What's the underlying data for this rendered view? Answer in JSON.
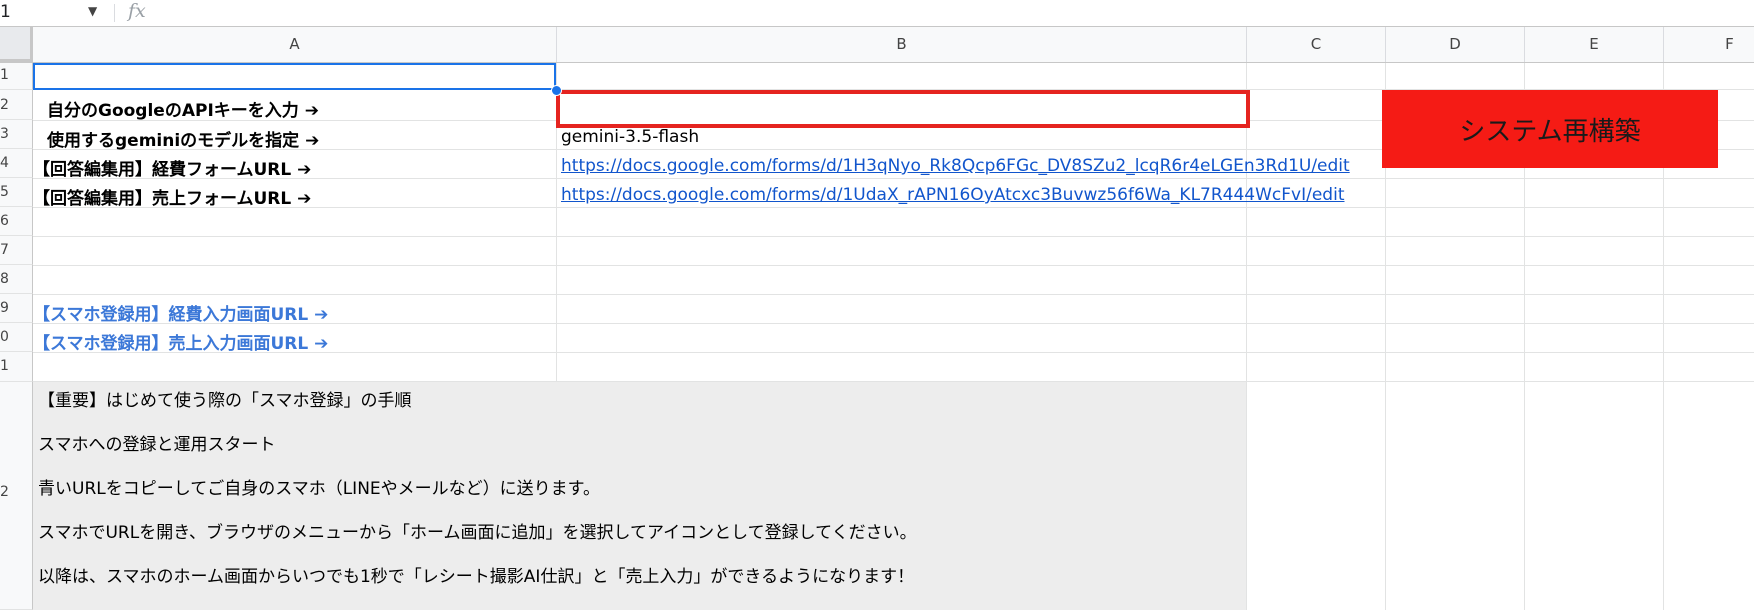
{
  "formula_bar": {
    "name_box": "1",
    "fx_label": "fx"
  },
  "columns": [
    "A",
    "B",
    "C",
    "D",
    "E",
    "F"
  ],
  "rows": [
    "1",
    "2",
    "3",
    "4",
    "5",
    "6",
    "7",
    "8",
    "9",
    "0",
    "1",
    "2"
  ],
  "cells": {
    "a2": "自分のGoogleのAPIキーを入力 ➔",
    "a3": "使用するgeminiのモデルを指定 ➔",
    "a4": "【回答編集用】経費フォームURL ➔",
    "a5": "【回答編集用】売上フォームURL ➔",
    "a9": "【スマホ登録用】経費入力画面URL ➔",
    "a10": "【スマホ登録用】売上入力画面URL ➔",
    "b2": "",
    "b3": "gemini-3.5-flash",
    "b4": "https://docs.google.com/forms/d/1H3qNyo_Rk8Qcp6FGc_DV8SZu2_lcqR6r4eLGEn3Rd1U/edit",
    "b5": "https://docs.google.com/forms/d/1UdaX_rAPN16OyAtcxc3Buvwz56f6Wa_KL7R444WcFvI/edit"
  },
  "note_lines": [
    "【重要】はじめて使う際の「スマホ登録」の手順",
    "スマホへの登録と運用スタート",
    "青いURLをコピーしてご自身のスマホ（LINEやメールなど）に送ります。",
    "スマホでURLを開き、ブラウザのメニューから「ホーム画面に追加」を選択してアイコンとして登録してください。",
    "以降は、スマホのホーム画面からいつでも1秒で「レシート撮影AI仕訳」と「売上入力」ができるようになります！"
  ],
  "rebuild_button": "システム再構築",
  "colors": {
    "button_bg": "#f51b15",
    "input_border": "#e52420",
    "link": "#1155cc",
    "label_blue": "#3c78d8",
    "note_bg": "#ededed"
  }
}
